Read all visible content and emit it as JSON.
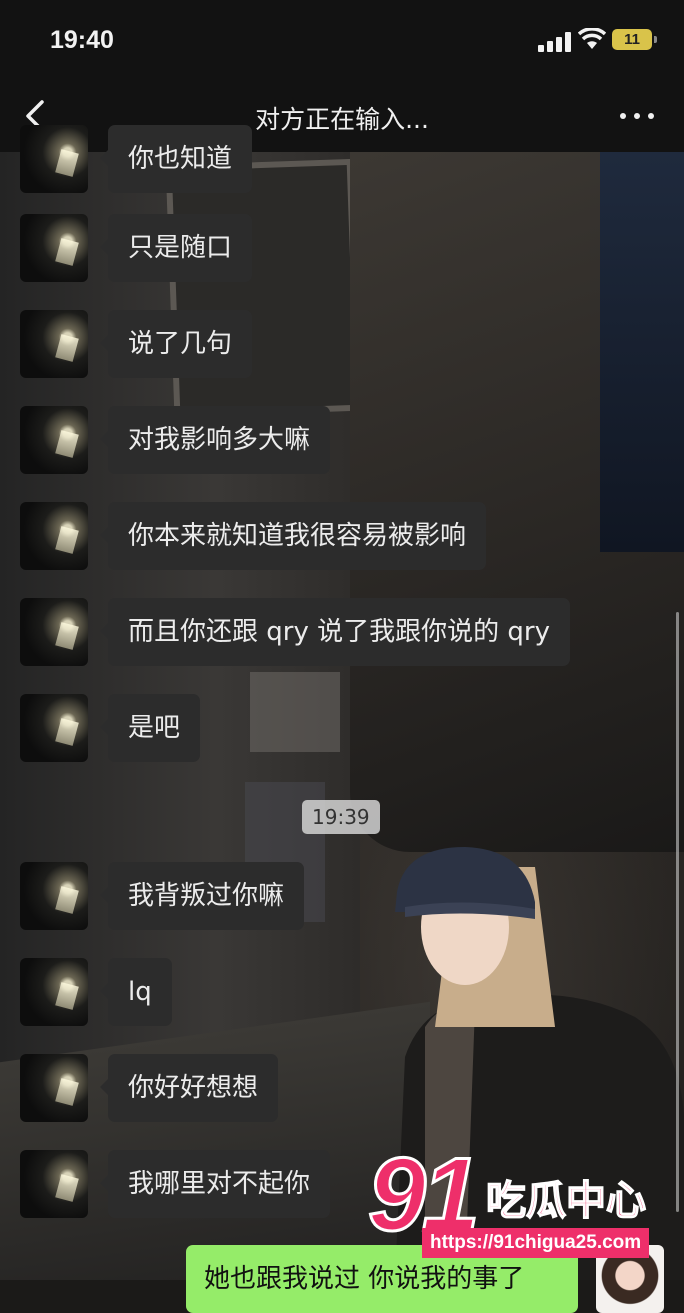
{
  "status_bar": {
    "time": "19:40",
    "battery": "11",
    "icons": [
      "signal-icon",
      "wifi-icon",
      "battery-icon"
    ]
  },
  "nav": {
    "title": "对方正在输入...",
    "back_icon": "chevron-left-icon",
    "more_icon": "more-dots-icon"
  },
  "messages": [
    {
      "text": "你也知道",
      "sender": "other"
    },
    {
      "text": "只是随口",
      "sender": "other"
    },
    {
      "text": "说了几句",
      "sender": "other"
    },
    {
      "text": "对我影响多大嘛",
      "sender": "other"
    },
    {
      "text": "你本来就知道我很容易被影响",
      "sender": "other"
    },
    {
      "text": "而且你还跟 qry 说了我跟你说的 qry",
      "sender": "other"
    },
    {
      "text": "是吧",
      "sender": "other"
    },
    {
      "text": "我背叛过你嘛",
      "sender": "other"
    },
    {
      "text": "lq",
      "sender": "other"
    },
    {
      "text": "你好好想想",
      "sender": "other"
    },
    {
      "text": "我哪里对不起你",
      "sender": "other"
    }
  ],
  "timestamp": "19:39",
  "my_message": {
    "text": "她也跟我说过 你说我的事了",
    "sender": "me"
  },
  "watermark": {
    "number": "91",
    "brand": "吃瓜中心",
    "url": "https://91chigua25.com",
    "color": "#ee2f6a"
  },
  "colors": {
    "bubble_other": "#2c2c2c",
    "bubble_mine": "#95ec69",
    "bar_bg": "#121212"
  }
}
